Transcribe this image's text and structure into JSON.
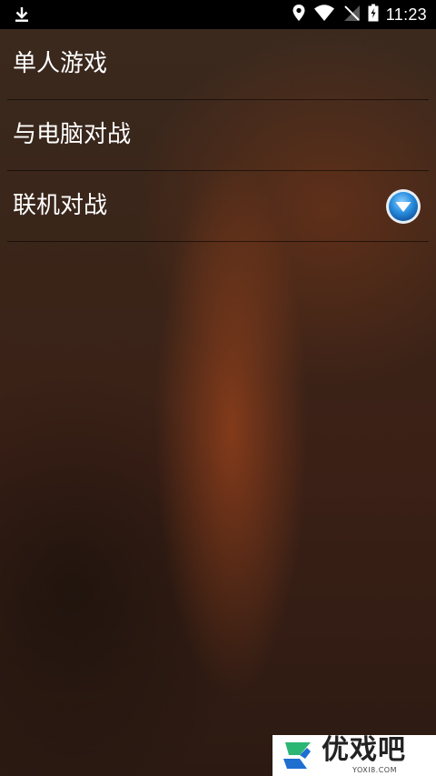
{
  "status_bar": {
    "time": "11:23",
    "icons": [
      "download-icon",
      "location-icon",
      "wifi-icon",
      "no-sim-icon",
      "battery-charging-icon"
    ]
  },
  "menu": {
    "items": [
      {
        "label": "单人游戏"
      },
      {
        "label": "与电脑对战"
      },
      {
        "label": "联机对战",
        "has_dropdown": true
      }
    ]
  },
  "watermark": {
    "title": "优戏吧",
    "subtitle": "YOXI8.COM"
  },
  "colors": {
    "dropdown_button": "#2b8fe0",
    "watermark_logo_green": "#2bb673",
    "watermark_logo_blue": "#1f6fd1"
  }
}
